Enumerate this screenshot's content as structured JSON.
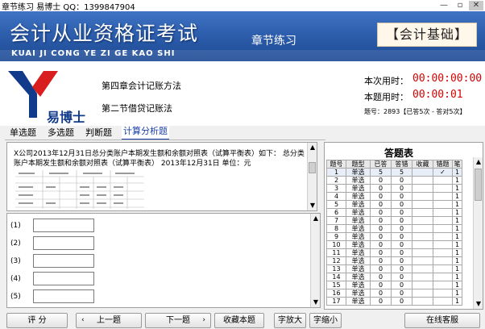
{
  "window": {
    "title": "章节练习  易博士  QQ：1399847904",
    "minimize_glyph": "—",
    "restore_glyph": "▫",
    "close_glyph": "✕"
  },
  "banner": {
    "main_title": "会计从业资格证考试",
    "pinyin": "KUAI JI CONG YE ZI GE KAO SHI",
    "section_title": "章节练习",
    "subject_badge": "【会计基础】"
  },
  "header": {
    "logo_text": "易博士",
    "chapter": "第四章会计记账方法",
    "section": "第二节借贷记账法",
    "this_time_label": "本次用时：",
    "this_time_value": "00:00:00:00",
    "question_time_label": "本题用时：",
    "question_time_value": "00:00:01",
    "stats": "题号：2893【已答5次 - 答对5次】"
  },
  "tabs": [
    {
      "label": "单选题",
      "active": false
    },
    {
      "label": "多选题",
      "active": false
    },
    {
      "label": "判断题",
      "active": false
    },
    {
      "label": "计算分析题",
      "active": true
    }
  ],
  "question": {
    "text": "X公司2013年12月31日总分类账户本期发生额和余额对照表（试算平衡表）如下：  总分类账户本期发生额和余额对照表（试算平衡表）  2013年12月31日  单位：元"
  },
  "answers": [
    {
      "label": "(1)"
    },
    {
      "label": "(2)"
    },
    {
      "label": "(3)"
    },
    {
      "label": "(4)"
    },
    {
      "label": "(5)"
    }
  ],
  "answer_sheet": {
    "title": "答题表",
    "columns": [
      "题号",
      "题型",
      "已答",
      "答错",
      "收藏",
      "错题",
      "笔"
    ],
    "rows": [
      [
        "1",
        "单选",
        "5",
        "5",
        "",
        "✓",
        "1"
      ],
      [
        "2",
        "单选",
        "0",
        "0",
        "",
        "",
        "1"
      ],
      [
        "3",
        "单选",
        "0",
        "0",
        "",
        "",
        "1"
      ],
      [
        "4",
        "单选",
        "0",
        "0",
        "",
        "",
        "1"
      ],
      [
        "5",
        "单选",
        "0",
        "0",
        "",
        "",
        "1"
      ],
      [
        "6",
        "单选",
        "0",
        "0",
        "",
        "",
        "1"
      ],
      [
        "7",
        "单选",
        "0",
        "0",
        "",
        "",
        "1"
      ],
      [
        "8",
        "单选",
        "0",
        "0",
        "",
        "",
        "1"
      ],
      [
        "9",
        "单选",
        "0",
        "0",
        "",
        "",
        "1"
      ],
      [
        "10",
        "单选",
        "0",
        "0",
        "",
        "",
        "1"
      ],
      [
        "11",
        "单选",
        "0",
        "0",
        "",
        "",
        "1"
      ],
      [
        "12",
        "单选",
        "0",
        "0",
        "",
        "",
        "1"
      ],
      [
        "13",
        "单选",
        "0",
        "0",
        "",
        "",
        "1"
      ],
      [
        "14",
        "单选",
        "0",
        "0",
        "",
        "",
        "1"
      ],
      [
        "15",
        "单选",
        "0",
        "0",
        "",
        "",
        "1"
      ],
      [
        "16",
        "单选",
        "0",
        "0",
        "",
        "",
        "1"
      ],
      [
        "17",
        "单选",
        "0",
        "0",
        "",
        "",
        "1"
      ]
    ]
  },
  "buttons": {
    "grade": "评 分",
    "prev": "上一题",
    "next": "下一题",
    "favorite": "收藏本题",
    "zoom_in": "字放大",
    "zoom_out": "字缩小",
    "online": "在线客服"
  },
  "colors": {
    "timer": "#d40000",
    "active_tab": "#1c3fa8",
    "banner": "#2a5aa8"
  }
}
